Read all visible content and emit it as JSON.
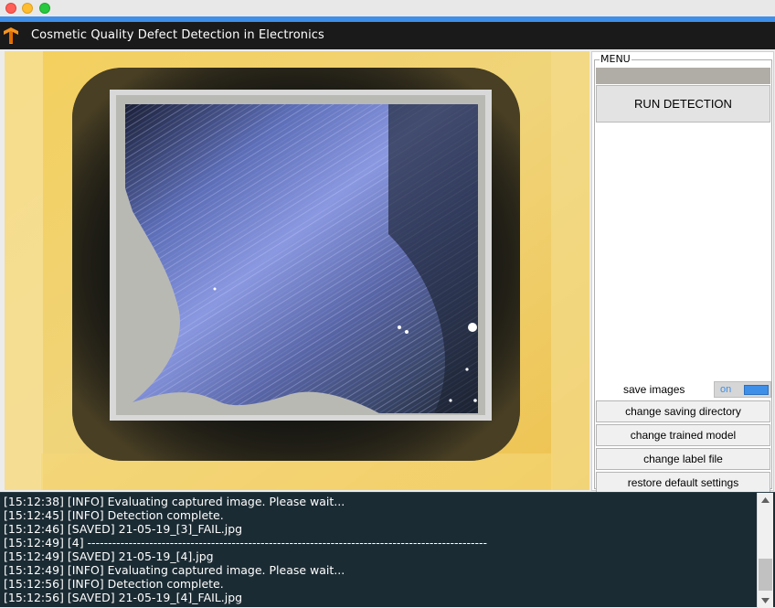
{
  "window": {
    "title": "Cosmetic Quality Defect Detection in Electronics",
    "app_icon": "tensorflow-logo-icon",
    "controls": [
      "close",
      "minimize",
      "zoom"
    ]
  },
  "menu": {
    "group_label": "MENU",
    "status_text": "",
    "run_button": "RUN DETECTION",
    "save_images_label": "save images",
    "save_images_toggle": "on",
    "buttons": [
      "change saving directory",
      "change trained model",
      "change label file",
      "restore default settings"
    ]
  },
  "colors": {
    "accent": "#3d8fe8",
    "titlebar": "#1a1a1a",
    "log_background": "#1b2b33",
    "log_text": "#ffffff"
  },
  "log": [
    "[15:12:38] [INFO] Evaluating captured image. Please wait...",
    "[15:12:45] [INFO] Detection complete.",
    "[15:12:46] [SAVED] 21-05-19_[3]_FAIL.jpg",
    "[15:12:49] [4] -------------------------------------------------------------------------------------------------",
    "[15:12:49] [SAVED] 21-05-19_[4].jpg",
    "[15:12:49] [INFO] Evaluating captured image. Please wait...",
    "[15:12:56] [INFO] Detection complete.",
    "[15:12:56] [SAVED] 21-05-19_[4]_FAIL.jpg"
  ]
}
